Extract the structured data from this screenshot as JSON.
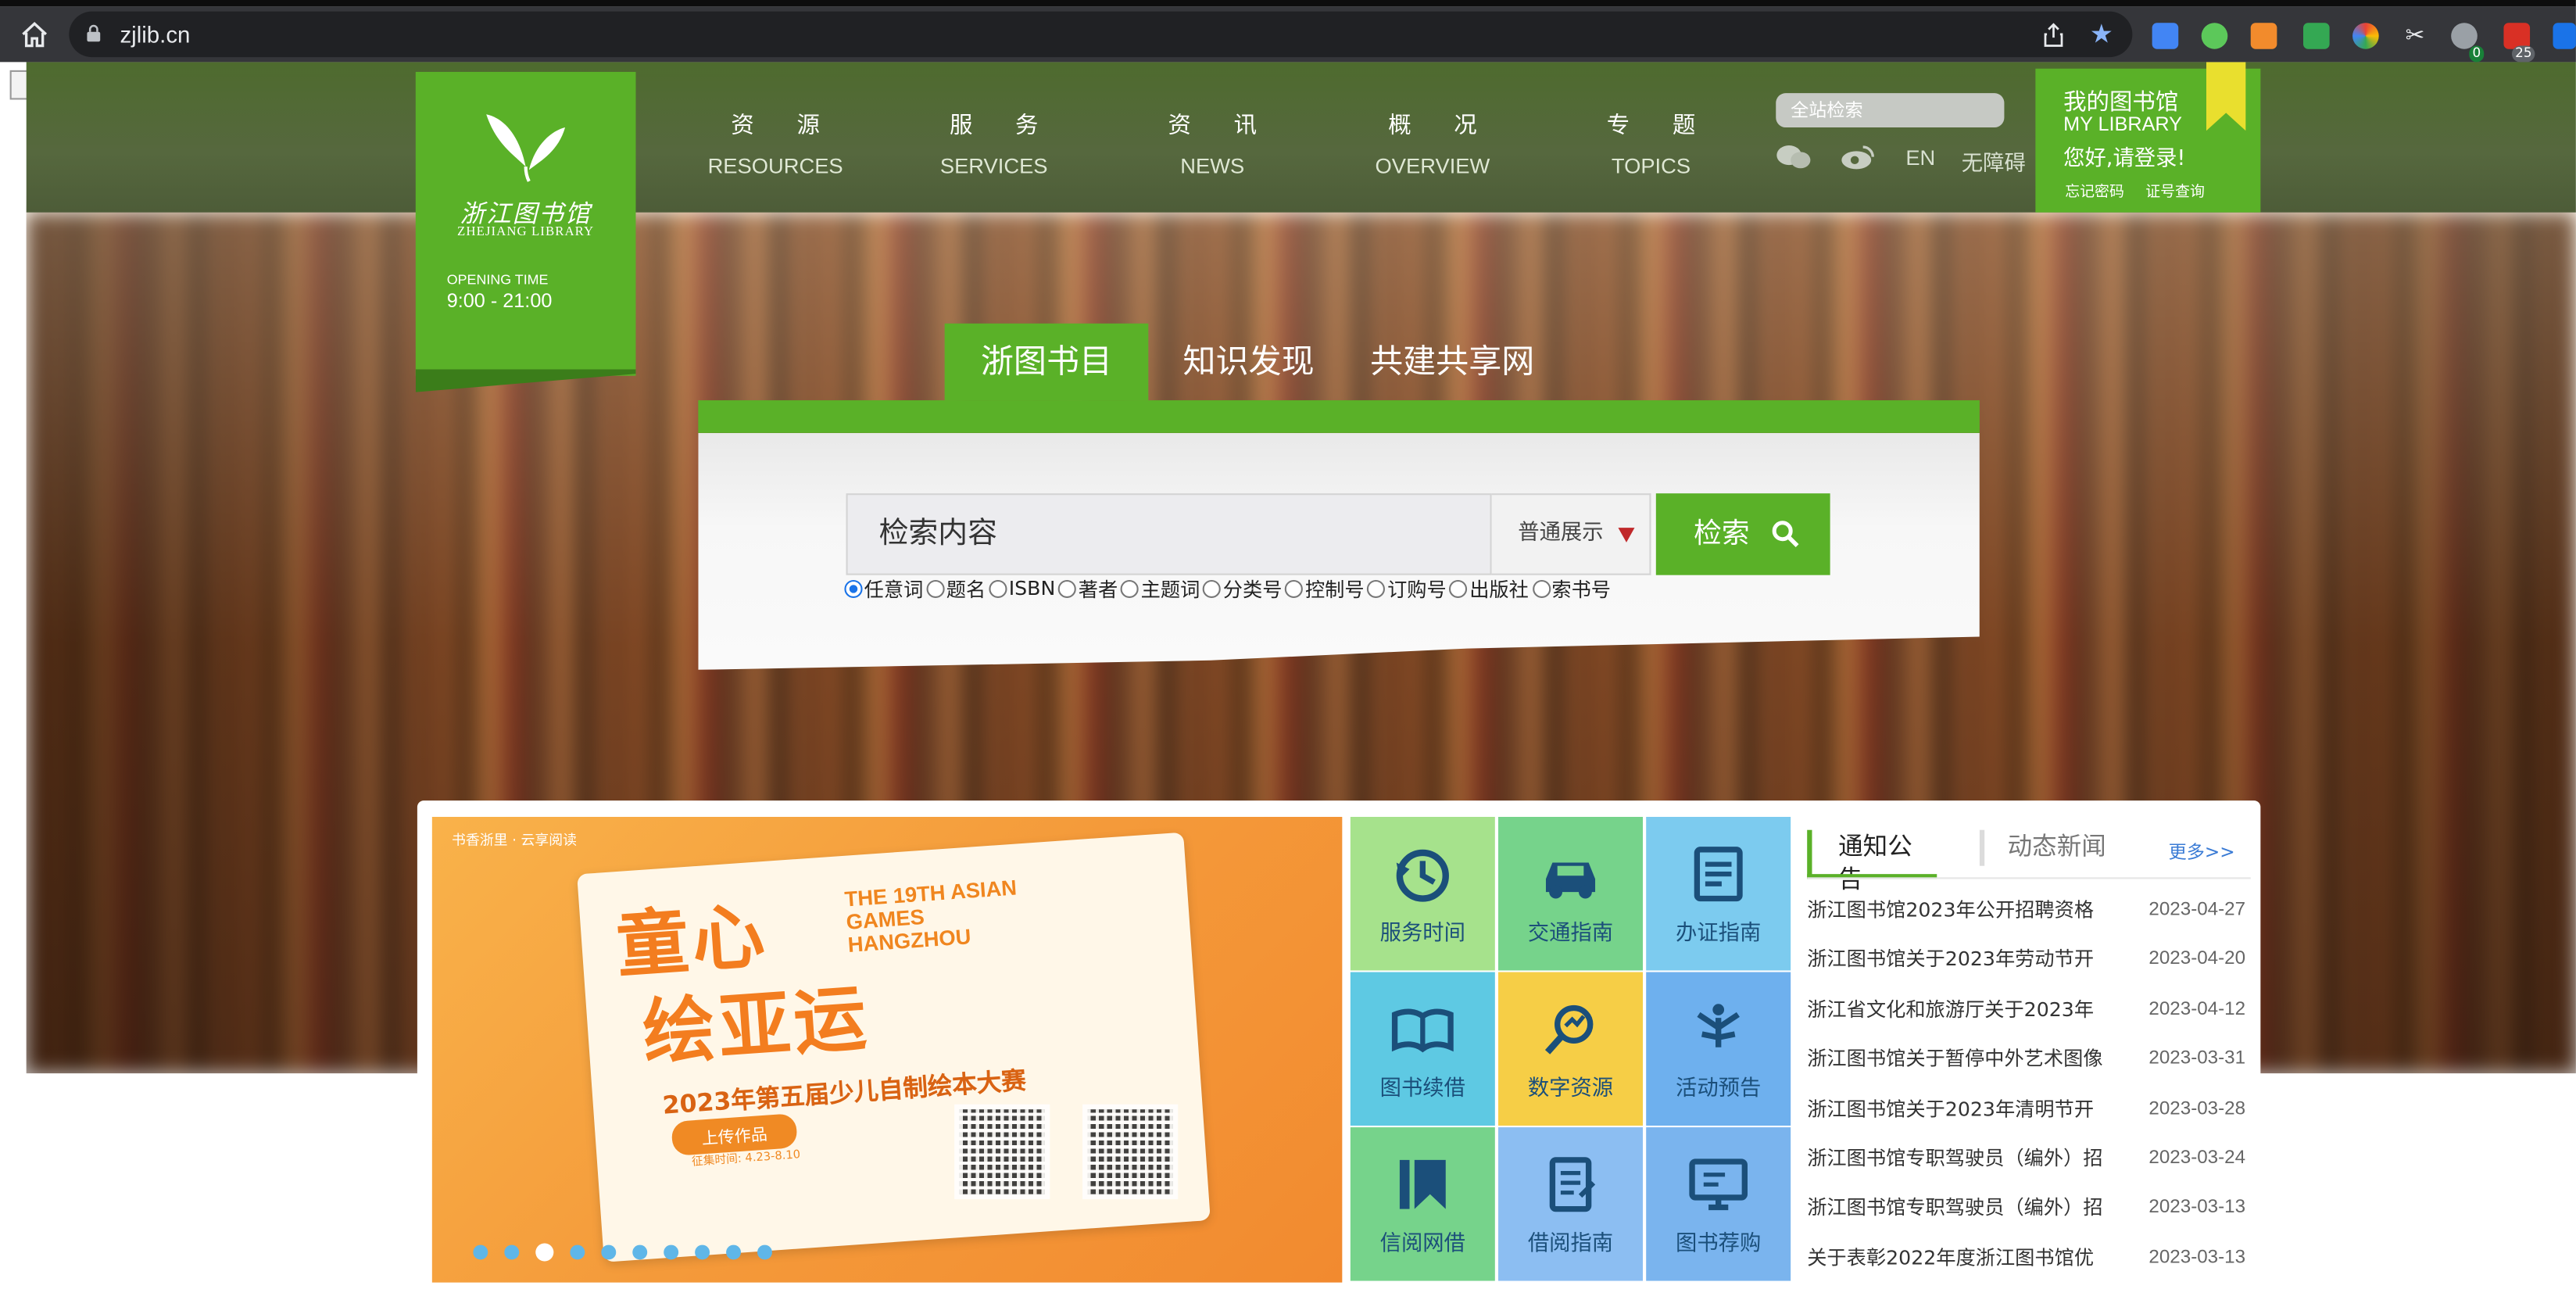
{
  "browser": {
    "url": "zjlib.cn"
  },
  "extensions": {
    "badge_a": "0",
    "badge_b": "25"
  },
  "header": {
    "logo_title": "浙江图书馆",
    "logo_subtitle": "ZHEJIANG LIBRARY",
    "opening_label": "OPENING TIME",
    "opening_hours": "9:00 - 21:00",
    "nav": [
      {
        "cn": "资源",
        "en": "RESOURCES"
      },
      {
        "cn": "服务",
        "en": "SERVICES"
      },
      {
        "cn": "资讯",
        "en": "NEWS"
      },
      {
        "cn": "概况",
        "en": "OVERVIEW"
      },
      {
        "cn": "专题",
        "en": "TOPICS"
      }
    ],
    "site_search_placeholder": "全站检索",
    "lang": "EN",
    "accessibility": "无障碍",
    "my_library": {
      "title": "我的图书馆",
      "title_en": "MY LIBRARY",
      "greeting": "您好,请登录!",
      "forgot_password": "忘记密码",
      "card_lookup": "证号查询"
    }
  },
  "search": {
    "tabs": [
      "浙图书目",
      "知识发现",
      "共建共享网"
    ],
    "active_tab": 0,
    "input_placeholder": "检索内容",
    "mode": "普通展示",
    "button": "检索",
    "options": [
      "任意词",
      "题名",
      "ISBN",
      "著者",
      "主题词",
      "分类号",
      "控制号",
      "订购号",
      "出版社",
      "索书号"
    ],
    "selected_option": 0
  },
  "banner": {
    "publisher": "书香浙里 · 云享阅读",
    "headline_1": "童心",
    "headline_2": "绘亚运",
    "event_en": "THE 19TH ASIAN GAMES HANGZHOU",
    "contest": "2023年第五届少儿自制绘本大赛",
    "upload": "上传作品",
    "period": "征集时间: 4.23-8.10",
    "slide_count": 10,
    "active_slide": 2
  },
  "services": [
    {
      "label": "服务时间",
      "icon": "clock-icon",
      "bg": "#a6e28c"
    },
    {
      "label": "交通指南",
      "icon": "car-icon",
      "bg": "#76d38b"
    },
    {
      "label": "办证指南",
      "icon": "card-icon",
      "bg": "#7ccbef"
    },
    {
      "label": "图书续借",
      "icon": "book-open-icon",
      "bg": "#5ec9e3"
    },
    {
      "label": "数字资源",
      "icon": "digital-icon",
      "bg": "#f6ce46"
    },
    {
      "label": "活动预告",
      "icon": "activity-icon",
      "bg": "#6eb0ee"
    },
    {
      "label": "信阅网借",
      "icon": "bookmark-icon",
      "bg": "#76d38b"
    },
    {
      "label": "借阅指南",
      "icon": "guide-icon",
      "bg": "#8cbef2"
    },
    {
      "label": "图书荐购",
      "icon": "computer-icon",
      "bg": "#7ab4ee"
    }
  ],
  "news": {
    "tab_notice": "通知公告",
    "tab_news": "动态新闻",
    "more": "更多>>",
    "items": [
      {
        "title": "浙江图书馆2023年公开招聘资格",
        "date": "2023-04-27"
      },
      {
        "title": "浙江图书馆关于2023年劳动节开",
        "date": "2023-04-20"
      },
      {
        "title": "浙江省文化和旅游厅关于2023年",
        "date": "2023-04-12"
      },
      {
        "title": "浙江图书馆关于暂停中外艺术图像",
        "date": "2023-03-31"
      },
      {
        "title": "浙江图书馆关于2023年清明节开",
        "date": "2023-03-28"
      },
      {
        "title": "浙江图书馆专职驾驶员（编外）招",
        "date": "2023-03-24"
      },
      {
        "title": "浙江图书馆专职驾驶员（编外）招",
        "date": "2023-03-13"
      },
      {
        "title": "关于表彰2022年度浙江图书馆优",
        "date": "2023-03-13"
      }
    ]
  }
}
